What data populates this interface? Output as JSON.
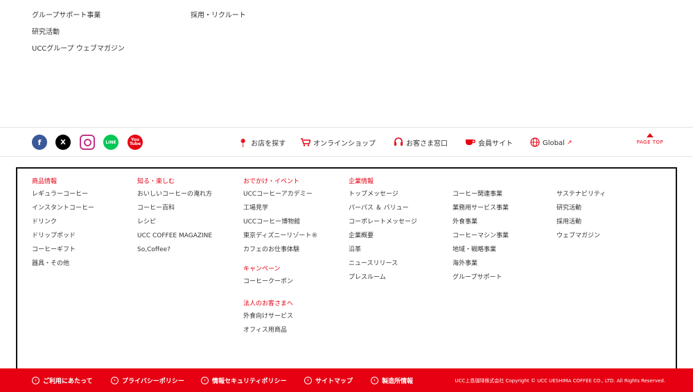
{
  "top_links": {
    "group_support": "グループサポート事業",
    "recruit": "採用・リクルート",
    "research": "研究活動",
    "web_magazine": "UCCグループ ウェブマガジン"
  },
  "social": {
    "facebook": "f",
    "x": "X",
    "instagram": "",
    "line": "LINE",
    "youtube": "You\nTube"
  },
  "nav": {
    "store": "お店を探す",
    "online_shop": "オンラインショップ",
    "customer": "お客さま窓口",
    "member": "会員サイト",
    "global": "Global",
    "page_top": "PAGE TOP"
  },
  "sitemap": {
    "products": {
      "heading": "商品情報",
      "links": [
        "レギュラーコーヒー",
        "インスタントコーヒー",
        "ドリンク",
        "ドリップポッド",
        "コーヒーギフト",
        "器具・その他"
      ]
    },
    "enjoy": {
      "heading": "知る・楽しむ",
      "links": [
        "おいしいコーヒーの淹れ方",
        "コーヒー百科",
        "レシピ",
        "UCC COFFEE MAGAZINE",
        "So,Coffee?"
      ]
    },
    "events": {
      "heading": "おでかけ・イベント",
      "links": [
        "UCCコーヒーアカデミー",
        "工場見学",
        "UCCコーヒー博物館",
        "東京ディズニーリゾート®",
        "カフェのお仕事体験"
      ],
      "campaign_heading": "キャンペーン",
      "campaign_links": [
        "コーヒークーポン"
      ],
      "business_heading": "法人のお客さまへ",
      "business_links": [
        "外食向けサービス",
        "オフィス用商品"
      ]
    },
    "company": {
      "heading": "企業情報",
      "links": [
        "トップメッセージ",
        "パーパス ＆ バリュー",
        "コーポレートメッセージ",
        "企業概要",
        "沿革",
        "ニュースリリース",
        "プレスルーム"
      ]
    },
    "company2": {
      "links": [
        "コーヒー関連事業",
        "業務用サービス事業",
        "外食事業",
        "コーヒーマシン事業",
        "地域・戦略事業",
        "海外事業",
        "グループサポート"
      ]
    },
    "company3": {
      "links": [
        "サステナビリティ",
        "研究活動",
        "採用活動",
        "ウェブマガジン"
      ]
    }
  },
  "footer": {
    "terms": "ご利用にあたって",
    "privacy": "プライバシーポリシー",
    "security": "情報セキュリティポリシー",
    "sitemap": "サイトマップ",
    "factory": "製造所情報",
    "copyright": "UCC上島珈琲株式会社 Copyright © UCC UESHIMA COFFEE CO., LTD. All Rights Reserved."
  },
  "colors": {
    "brand_red": "#e60012"
  }
}
